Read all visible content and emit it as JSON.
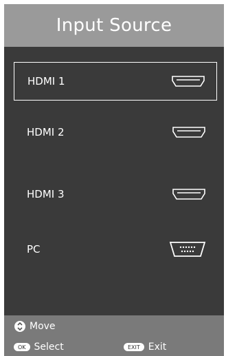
{
  "header": {
    "title": "Input Source"
  },
  "sources": [
    {
      "label": "HDMI 1",
      "icon": "hdmi-port-icon",
      "selected": true
    },
    {
      "label": "HDMI 2",
      "icon": "hdmi-port-icon",
      "selected": false
    },
    {
      "label": "HDMI 3",
      "icon": "hdmi-port-icon",
      "selected": false
    },
    {
      "label": "PC",
      "icon": "vga-port-icon",
      "selected": false
    }
  ],
  "footer": {
    "move_label": "Move",
    "ok_key": "OK",
    "select_label": "Select",
    "exit_key": "EXIT",
    "exit_label": "Exit"
  },
  "colors": {
    "header_bg": "#9a9a9a",
    "panel_bg": "#3a3a3a",
    "footer_bg": "#7a7a7a",
    "text": "#ffffff"
  }
}
